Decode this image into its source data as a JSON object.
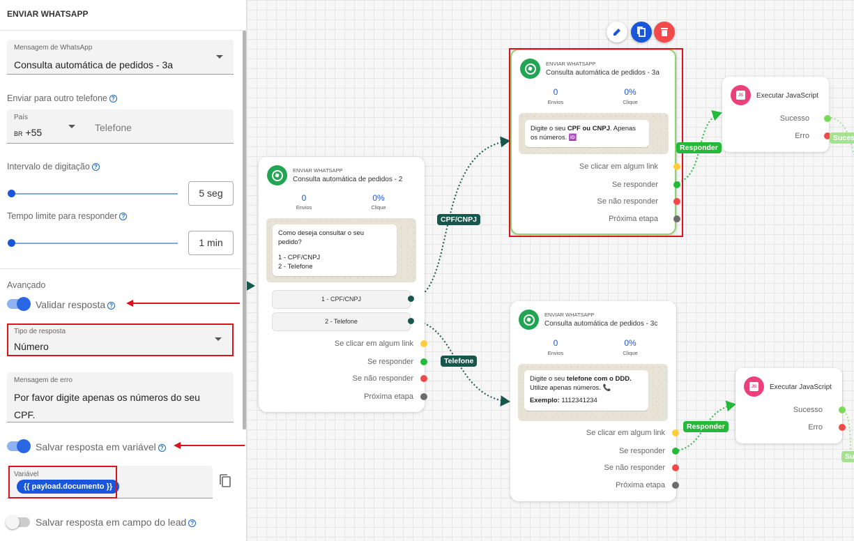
{
  "panel": {
    "title": "ENVIAR WHATSAPP",
    "message": {
      "label": "Mensagem de WhatsApp",
      "value": "Consulta automática de pedidos - 3a"
    },
    "other_phone": {
      "label": "Enviar para outro telefone",
      "country_label": "País",
      "country_code": "BR",
      "country_dial": "+55",
      "phone_placeholder": "Telefone"
    },
    "typing_interval": {
      "label": "Intervalo de digitação",
      "value": "5 seg",
      "level": 0.0
    },
    "time_limit": {
      "label": "Tempo limite para responder",
      "value": "1 min",
      "level": 0.0
    },
    "advanced_label": "Avançado",
    "validate": {
      "label": "Validar resposta",
      "on": true
    },
    "response_type": {
      "label": "Tipo de resposta",
      "value": "Número"
    },
    "error_message": {
      "label": "Mensagem de erro",
      "value": "Por favor digite apenas os números do seu CPF."
    },
    "save_variable": {
      "label": "Salvar resposta em variável",
      "on": true
    },
    "variable": {
      "label": "Variável",
      "value": "{{ payload.documento }}"
    },
    "save_lead": {
      "label": "Salvar resposta em campo do lead",
      "on": false
    }
  },
  "toolbar": {
    "edit_icon": "pencil-icon",
    "copy_icon": "copy-icon",
    "delete_icon": "trash-icon"
  },
  "nodes": {
    "n2": {
      "type": "ENVIAR WHATSAPP",
      "title": "Consulta automática de pedidos - 2",
      "sends": "0",
      "sends_label": "Envios",
      "click_rate": "0%",
      "click_label": "Clique",
      "message_lines": [
        "Como deseja consultar o seu",
        "pedido?",
        "",
        "1 - CPF/CNPJ",
        "2 - Telefone"
      ],
      "options": [
        "1 - CPF/CNPJ",
        "2 - Telefone"
      ],
      "outputs": [
        "Se clicar em algum link",
        "Se responder",
        "Se não responder",
        "Próxima etapa"
      ]
    },
    "n3a": {
      "type": "ENVIAR WHATSAPP",
      "title": "Consulta automática de pedidos - 3a",
      "sends": "0",
      "sends_label": "Envios",
      "click_rate": "0%",
      "click_label": "Clique",
      "msg_pre": "Digite o seu ",
      "msg_bold": "CPF ou CNPJ",
      "msg_post": ". Apenas os números. 🆔",
      "outputs": [
        "Se clicar em algum link",
        "Se responder",
        "Se não responder",
        "Próxima etapa"
      ]
    },
    "n3c": {
      "type": "ENVIAR WHATSAPP",
      "title": "Consulta automática de pedidos - 3c",
      "sends": "0",
      "sends_label": "Envios",
      "click_rate": "0%",
      "click_label": "Clique",
      "msg_pre": "Digite o seu ",
      "msg_bold": "telefone com o DDD.",
      "msg_line2": "Utilize apenas números. 📞",
      "example_label": "Exemplo:",
      "example_value": " 1112341234",
      "outputs": [
        "Se clicar em algum link",
        "Se responder",
        "Se não responder",
        "Próxima etapa"
      ]
    },
    "js1": {
      "title": "Executar JavaScript",
      "success": "Sucesso",
      "error": "Erro",
      "icon": "js-file-icon"
    },
    "js2": {
      "title": "Executar JavaScript",
      "success": "Sucesso",
      "error": "Erro",
      "icon": "js-file-icon"
    }
  },
  "edges": {
    "cpf": "CPF/CNPJ",
    "telefone": "Telefone",
    "responder1": "Responder",
    "responder2": "Responder",
    "sucesso1": "Sucesso",
    "sucesso2": "Sucesso"
  },
  "colors": {
    "accent": "#1a56db",
    "whatsapp": "#21a553",
    "highlight": "#d9121b",
    "edge_dark": "#17574b",
    "edge_green": "#25b93c"
  }
}
